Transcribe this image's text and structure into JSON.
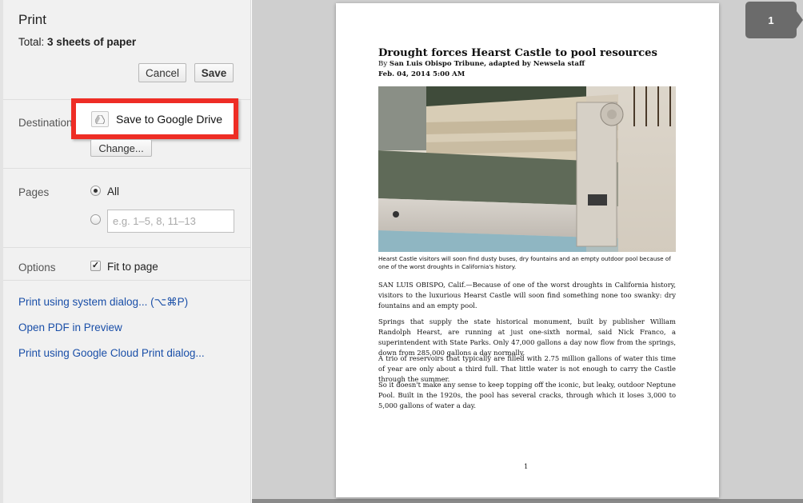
{
  "header": {
    "title": "Print",
    "total_label": "Total:",
    "total_value": "3 sheets of paper",
    "cancel_label": "Cancel",
    "save_label": "Save"
  },
  "destination": {
    "label": "Destination",
    "name": "Save to Google Drive",
    "change_label": "Change...",
    "icon": "google-drive-icon",
    "highlight_color": "#ee2d25"
  },
  "pages": {
    "label": "Pages",
    "all_label": "All",
    "selected": "All",
    "custom_placeholder": "e.g. 1–5, 8, 11–13"
  },
  "options": {
    "label": "Options",
    "fit_to_page_label": "Fit to page",
    "fit_to_page_checked": true
  },
  "links": [
    "Print using system dialog... (⌥⌘P)",
    "Open PDF in Preview",
    "Print using Google Cloud Print dialog..."
  ],
  "preview": {
    "page_badge": "1",
    "document": {
      "title": "Drought forces Hearst Castle to pool resources",
      "byline_prefix": "By",
      "byline": "San Luis Obispo Tribune, adapted by Newsela staff",
      "date": "Feb. 04, 2014 5:00 AM",
      "caption": "Hearst Castle visitors will soon find dusty buses, dry fountains and an empty outdoor pool because of one of the worst droughts in California's history.",
      "paragraphs": [
        "SAN LUIS OBISPO, Calif.—Because of one of the worst droughts in California history, visitors to the luxurious Hearst Castle will soon find something none too swanky: dry fountains and an empty pool.",
        "Springs that supply the state historical monument, built by publisher William Randolph Hearst, are running at just one-sixth normal, said Nick Franco, a superintendent with State Parks. Only 47,000 gallons a day now flow from the springs, down from 285,000 gallons a day normally.",
        "A trio of reservoirs that typically are filled with 2.75 million gallons of water this time of year are only about a third full. That little water is not enough to carry the Castle through the summer.",
        "So it doesn't make any sense to keep topping off the iconic, but leaky, outdoor Neptune Pool. Built in the 1920s, the pool has several cracks, through which it loses 3,000 to 5,000 gallons of water a day."
      ],
      "page_number": "1"
    }
  },
  "colors": {
    "link": "#1a4fa8",
    "sidebar_bg": "#f1f1f1",
    "preview_bg": "#cfcfcf"
  }
}
